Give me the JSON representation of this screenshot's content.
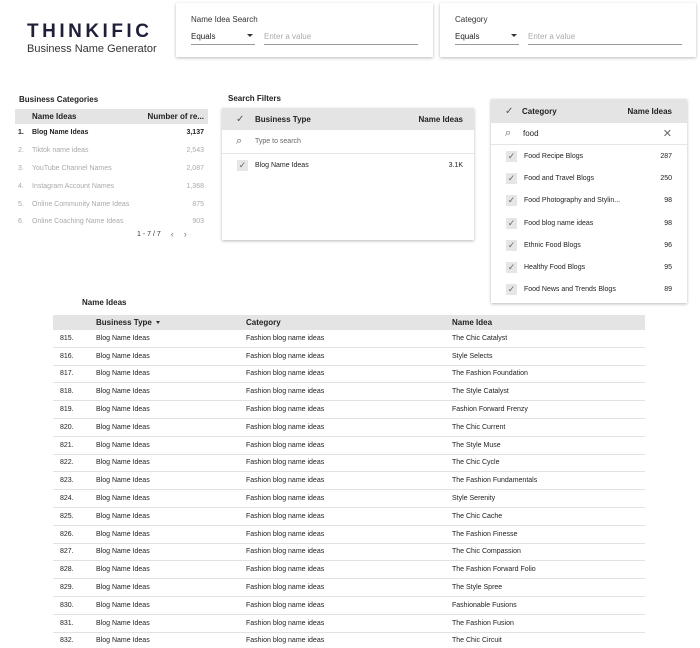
{
  "brand": {
    "logo": "THINKIFIC",
    "subtitle": "Business Name Generator"
  },
  "filters": [
    {
      "label": "Name Idea Search",
      "operator": "Equals",
      "placeholder": "Enter a value"
    },
    {
      "label": "Category",
      "operator": "Equals",
      "placeholder": "Enter a value"
    }
  ],
  "business_categories": {
    "title": "Business Categories",
    "col_name": "Name Ideas",
    "col_count": "Number of re...",
    "rows": [
      {
        "idx": "1.",
        "name": "Blog Name Ideas",
        "count": "3,137"
      },
      {
        "idx": "2.",
        "name": "Tiktok name ideas",
        "count": "2,543"
      },
      {
        "idx": "3.",
        "name": "YouTube Channel Names",
        "count": "2,087"
      },
      {
        "idx": "4.",
        "name": "Instagram Account Names",
        "count": "1,368"
      },
      {
        "idx": "5.",
        "name": "Online Community Name Ideas",
        "count": "875"
      },
      {
        "idx": "6.",
        "name": "Online Coaching Name Ideas",
        "count": "903"
      }
    ],
    "pager": "1 - 7 / 7",
    "prev_icon": "‹",
    "next_icon": "›"
  },
  "search_filters": {
    "title": "Search Filters",
    "col_type": "Business Type",
    "col_count": "Name Ideas",
    "search_placeholder": "Type to search",
    "rows": [
      {
        "name": "Blog Name Ideas",
        "count": "3.1K"
      }
    ]
  },
  "category_filter": {
    "col_category": "Category",
    "col_count": "Name Ideas",
    "search_value": "food",
    "rows": [
      {
        "name": "Food Recipe Blogs",
        "count": "287"
      },
      {
        "name": "Food and Travel Blogs",
        "count": "250"
      },
      {
        "name": "Food Photography and Stylin...",
        "count": "98"
      },
      {
        "name": "Food blog name ideas",
        "count": "98"
      },
      {
        "name": "Ethnic Food Blogs",
        "count": "96"
      },
      {
        "name": "Healthy Food Blogs",
        "count": "95"
      },
      {
        "name": "Food News and Trends Blogs",
        "count": "89"
      }
    ]
  },
  "name_ideas": {
    "title": "Name Ideas",
    "col_type": "Business Type",
    "col_category": "Category",
    "col_name": "Name Idea",
    "rows": [
      {
        "idx": "815.",
        "type": "Blog Name Ideas",
        "category": "Fashion blog name ideas",
        "name": "The Chic Catalyst"
      },
      {
        "idx": "816.",
        "type": "Blog Name Ideas",
        "category": "Fashion blog name ideas",
        "name": "Style Selects"
      },
      {
        "idx": "817.",
        "type": "Blog Name Ideas",
        "category": "Fashion blog name ideas",
        "name": "The Fashion Foundation"
      },
      {
        "idx": "818.",
        "type": "Blog Name Ideas",
        "category": "Fashion blog name ideas",
        "name": "The Style Catalyst"
      },
      {
        "idx": "819.",
        "type": "Blog Name Ideas",
        "category": "Fashion blog name ideas",
        "name": "Fashion Forward Frenzy"
      },
      {
        "idx": "820.",
        "type": "Blog Name Ideas",
        "category": "Fashion blog name ideas",
        "name": "The Chic Current"
      },
      {
        "idx": "821.",
        "type": "Blog Name Ideas",
        "category": "Fashion blog name ideas",
        "name": "The Style Muse"
      },
      {
        "idx": "822.",
        "type": "Blog Name Ideas",
        "category": "Fashion blog name ideas",
        "name": "The Chic Cycle"
      },
      {
        "idx": "823.",
        "type": "Blog Name Ideas",
        "category": "Fashion blog name ideas",
        "name": "The Fashion Fundamentals"
      },
      {
        "idx": "824.",
        "type": "Blog Name Ideas",
        "category": "Fashion blog name ideas",
        "name": "Style Serenity"
      },
      {
        "idx": "825.",
        "type": "Blog Name Ideas",
        "category": "Fashion blog name ideas",
        "name": "The Chic Cache"
      },
      {
        "idx": "826.",
        "type": "Blog Name Ideas",
        "category": "Fashion blog name ideas",
        "name": "The Fashion Finesse"
      },
      {
        "idx": "827.",
        "type": "Blog Name Ideas",
        "category": "Fashion blog name ideas",
        "name": "The Chic Compassion"
      },
      {
        "idx": "828.",
        "type": "Blog Name Ideas",
        "category": "Fashion blog name ideas",
        "name": "The Fashion Forward Folio"
      },
      {
        "idx": "829.",
        "type": "Blog Name Ideas",
        "category": "Fashion blog name ideas",
        "name": "The Style Spree"
      },
      {
        "idx": "830.",
        "type": "Blog Name Ideas",
        "category": "Fashion blog name ideas",
        "name": "Fashionable Fusions"
      },
      {
        "idx": "831.",
        "type": "Blog Name Ideas",
        "category": "Fashion blog name ideas",
        "name": "The Fashion Fusion"
      },
      {
        "idx": "832.",
        "type": "Blog Name Ideas",
        "category": "Fashion blog name ideas",
        "name": "The Chic Circuit"
      }
    ]
  },
  "icons": {
    "check": "check-icon",
    "search": "search-icon",
    "clear": "close-icon",
    "sort": "sort-desc-icon"
  }
}
